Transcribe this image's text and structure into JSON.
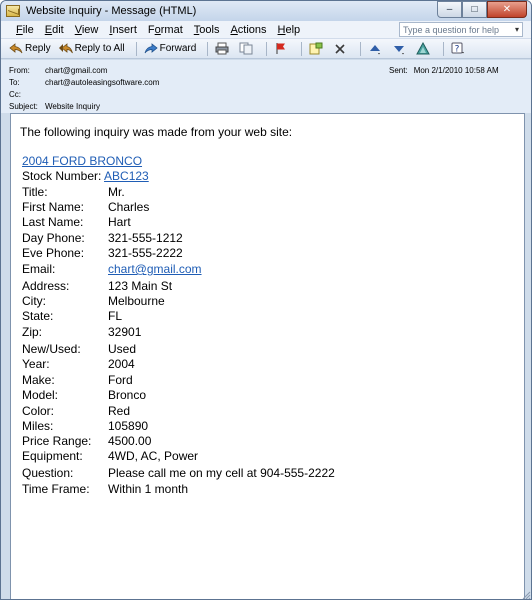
{
  "window": {
    "title": "Website Inquiry - Message (HTML)",
    "controls": [
      "–",
      "□",
      "✕"
    ]
  },
  "menu": {
    "items": [
      {
        "key": "F",
        "rest": "ile"
      },
      {
        "key": "E",
        "rest": "dit"
      },
      {
        "key": "V",
        "rest": "iew"
      },
      {
        "key": "I",
        "rest": "nsert"
      },
      {
        "key": "o",
        "pre": "F",
        "rest": "rmat"
      },
      {
        "key": "T",
        "rest": "ools"
      },
      {
        "key": "A",
        "rest": "ctions"
      },
      {
        "key": "H",
        "rest": "elp"
      }
    ],
    "help_placeholder": "Type a question for help"
  },
  "toolbar": {
    "reply": "Reply",
    "reply_all": "Reply to All",
    "forward": "Forward"
  },
  "message_header": {
    "from_label": "From:",
    "from_value": "chart@gmail.com",
    "to_label": "To:",
    "to_value": "chart@autoleasingsoftware.com",
    "cc_label": "Cc:",
    "cc_value": "",
    "subject_label": "Subject:",
    "subject_value": "Website Inquiry",
    "sent_label": "Sent:",
    "sent_value": "Mon 2/1/2010 10:58 AM"
  },
  "body": {
    "intro": "The following inquiry was made from your web site:",
    "listing_link": "2004 FORD BRONCO",
    "stock_label": "Stock Number:",
    "stock_value": "ABC123",
    "fields": [
      {
        "label": "Title:",
        "value": "Mr."
      },
      {
        "label": "First Name:",
        "value": "Charles"
      },
      {
        "label": "Last Name:",
        "value": "Hart"
      },
      {
        "label": "Day Phone:",
        "value": "321-555-1212"
      },
      {
        "label": "Eve Phone:",
        "value": "321-555-2222"
      },
      {
        "label": "Email:",
        "value": "chart@gmail.com"
      },
      {
        "label": "Address:",
        "value": "123 Main St"
      },
      {
        "label": "City:",
        "value": "Melbourne"
      },
      {
        "label": "State:",
        "value": "FL"
      },
      {
        "label": "Zip:",
        "value": "32901"
      },
      {
        "label": "New/Used:",
        "value": "Used"
      },
      {
        "label": "Year:",
        "value": "2004"
      },
      {
        "label": "Make:",
        "value": "Ford"
      },
      {
        "label": "Model:",
        "value": "Bronco"
      },
      {
        "label": "Color:",
        "value": "Red"
      },
      {
        "label": "Miles:",
        "value": "105890"
      },
      {
        "label": "Price Range:",
        "value": "4500.00"
      },
      {
        "label": "Equipment:",
        "value": "4WD, AC, Power"
      },
      {
        "label": "Question:",
        "value": "Please call me on my cell at 904-555-2222"
      },
      {
        "label": "Time Frame:",
        "value": "Within 1 month"
      }
    ]
  }
}
